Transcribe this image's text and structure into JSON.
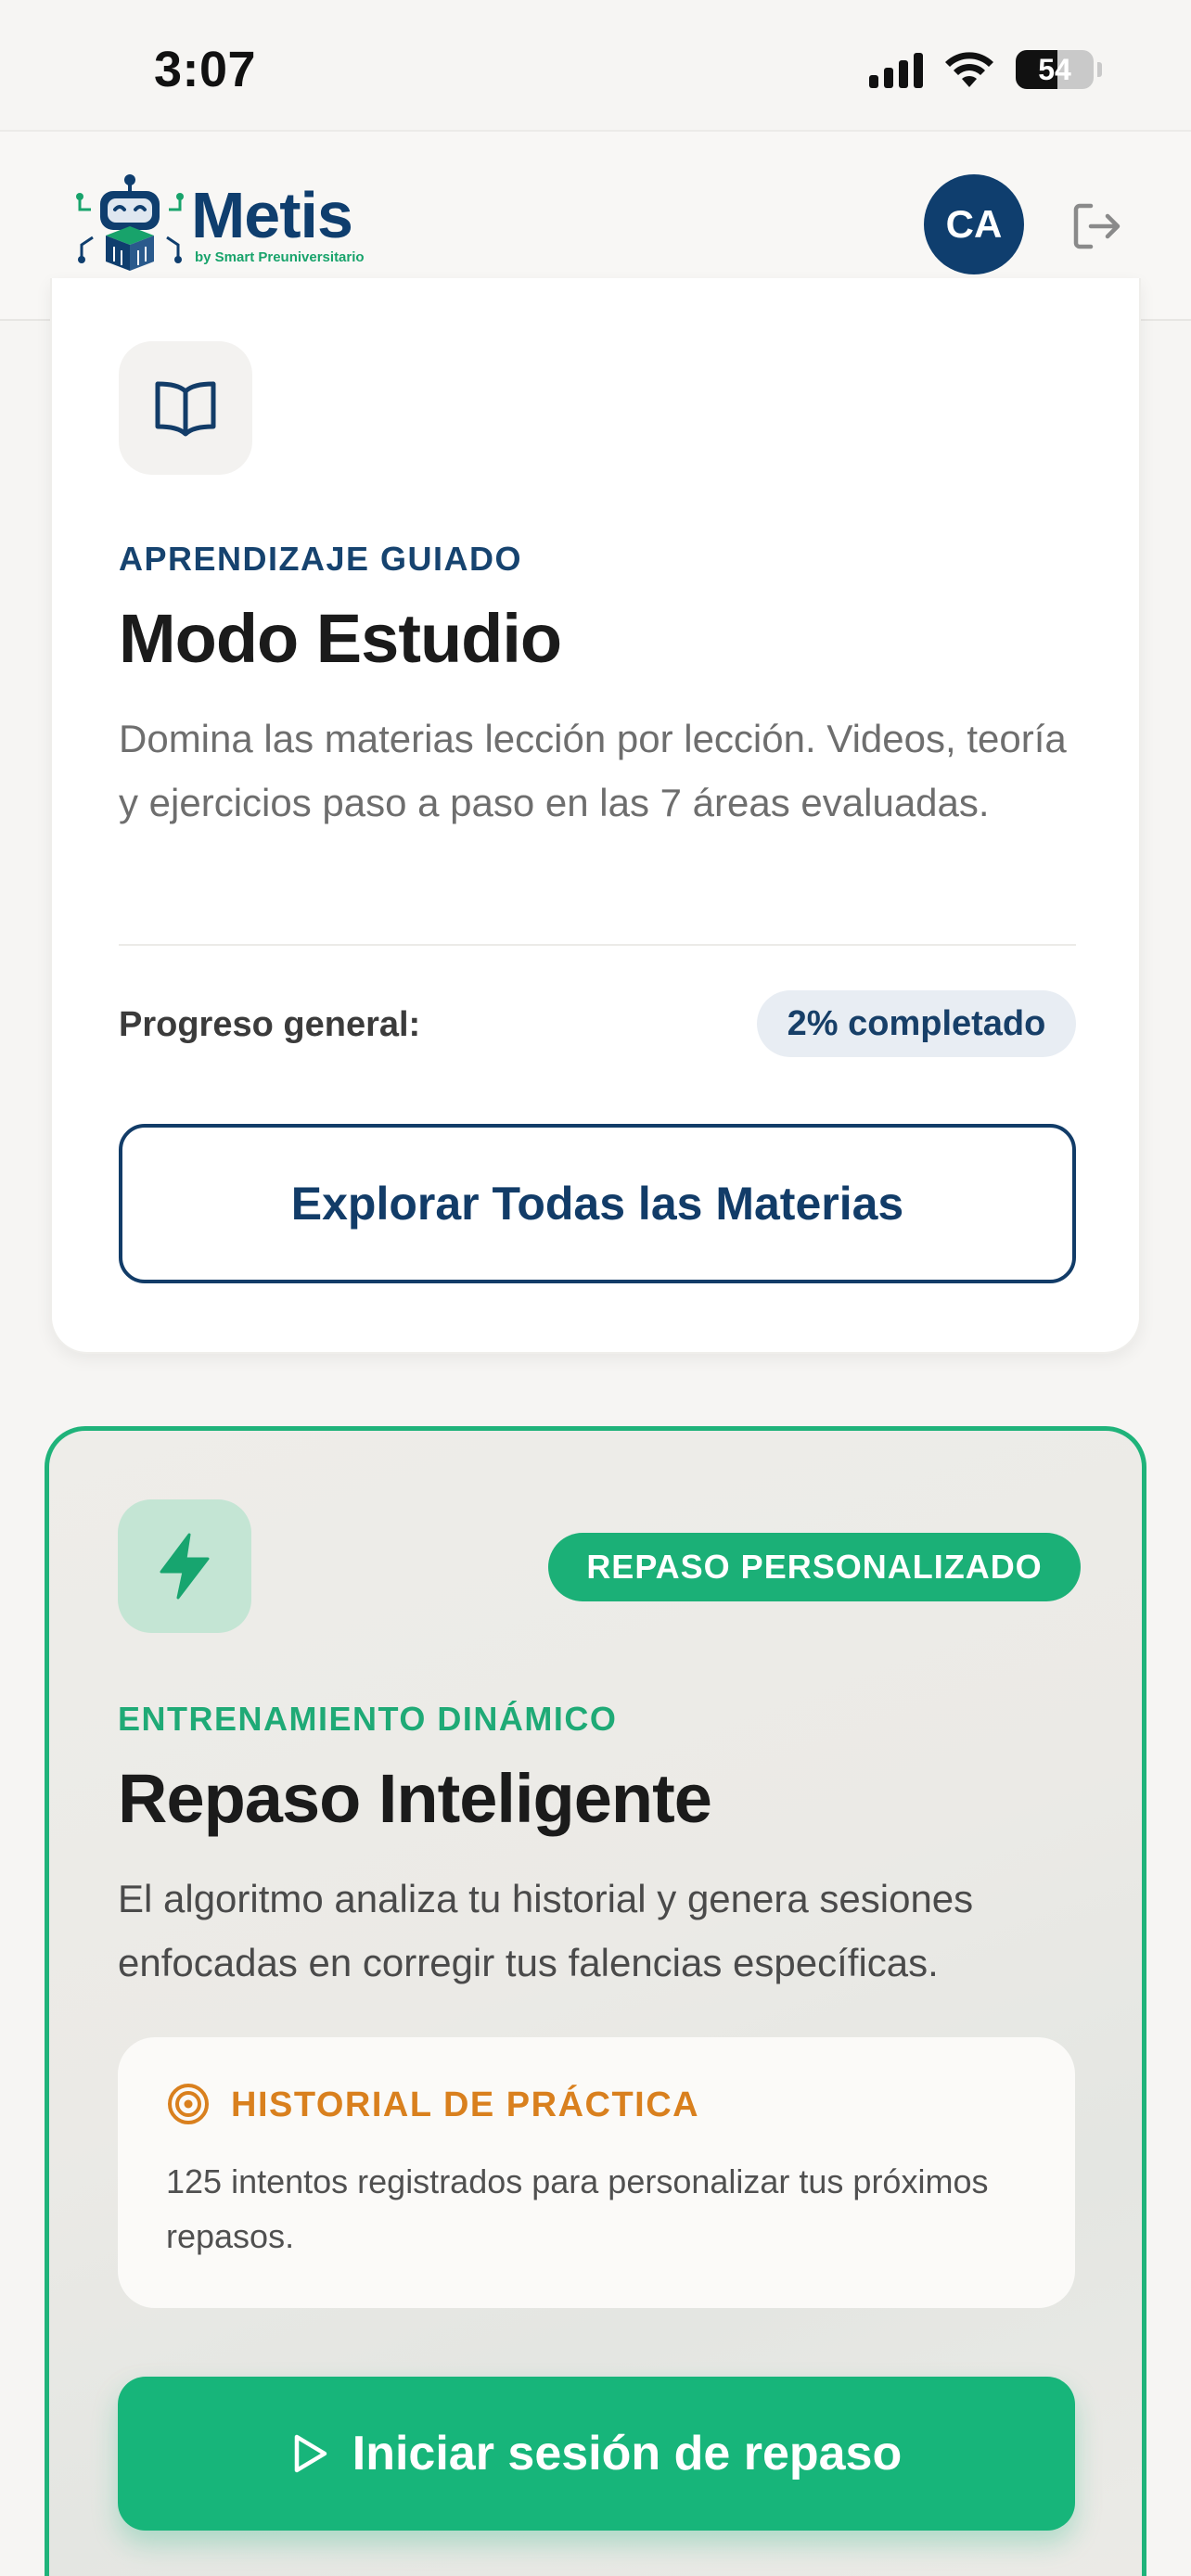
{
  "status_bar": {
    "time": "3:07",
    "battery_percent": "54"
  },
  "header": {
    "logo_title": "Metis",
    "logo_subtitle": "by Smart Preuniversitario",
    "avatar_initials": "CA"
  },
  "study_card": {
    "icon": "book-open-icon",
    "eyebrow": "APRENDIZAJE GUIADO",
    "title": "Modo Estudio",
    "description": "Domina las materias lección por lección. Videos, teoría y ejercicios paso a paso en las 7 áreas evaluadas.",
    "progress_label": "Progreso general:",
    "progress_badge": "2% completado",
    "progress_value": 0.02,
    "button_label": "Explorar Todas las Materias"
  },
  "review_card": {
    "icon": "lightning-bolt-icon",
    "badge": "REPASO PERSONALIZADO",
    "eyebrow": "ENTRENAMIENTO DINÁMICO",
    "title": "Repaso Inteligente",
    "description": "El algoritmo analiza tu historial y genera sesiones enfocadas en corregir tus falencias específicas.",
    "history": {
      "icon": "target-icon",
      "title": "HISTORIAL DE PRÁCTICA",
      "text": "125 intentos registrados para personalizar tus próximos repasos."
    },
    "button_label": "Iniciar sesión de repaso"
  },
  "colors": {
    "primary_navy": "#0f3e6e",
    "accent_green": "#17b57a",
    "history_orange": "#d9801e",
    "background": "#f6f5f3"
  }
}
